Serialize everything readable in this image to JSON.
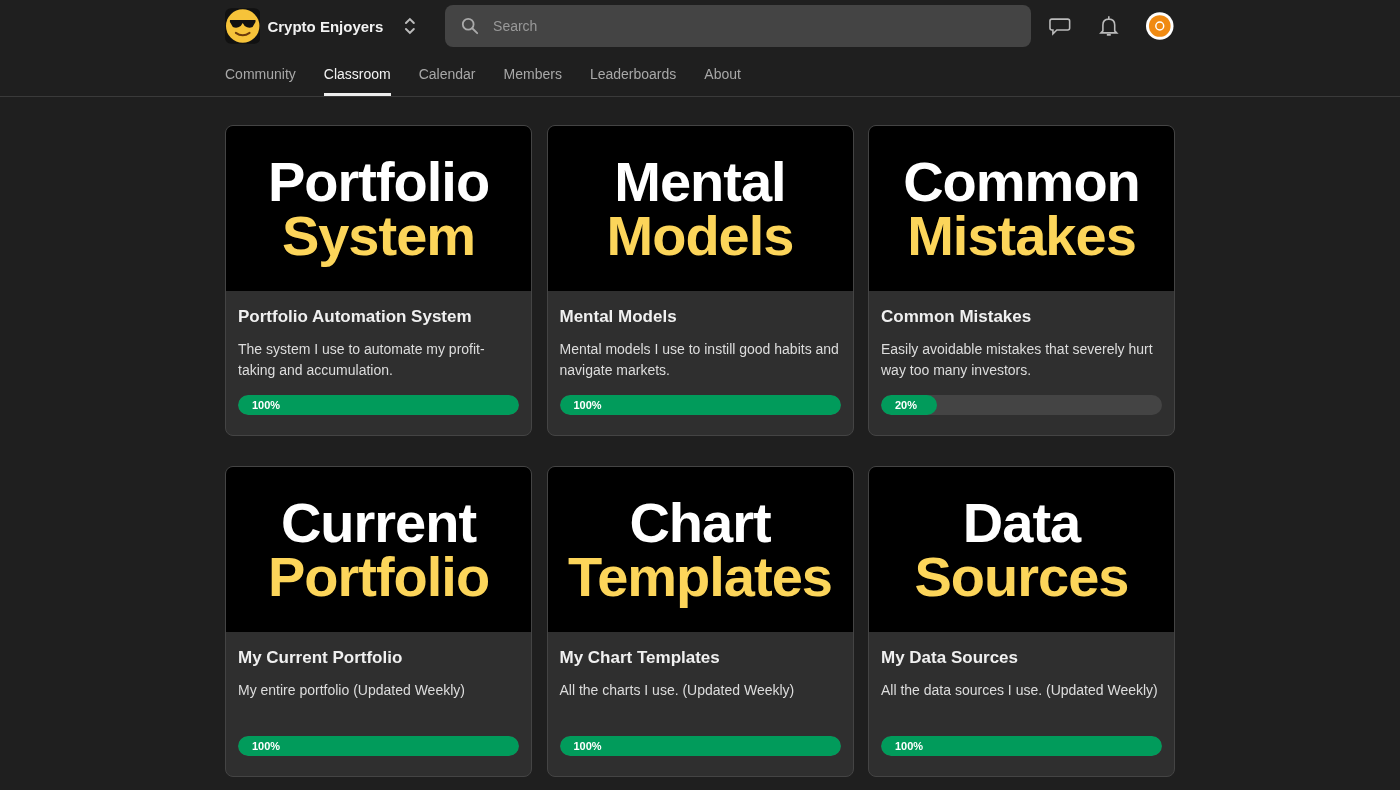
{
  "header": {
    "group_name": "Crypto Enjoyers",
    "search": {
      "placeholder": "Search"
    }
  },
  "tabs": [
    {
      "label": "Community",
      "selected": false
    },
    {
      "label": "Classroom",
      "selected": true
    },
    {
      "label": "Calendar",
      "selected": false
    },
    {
      "label": "Members",
      "selected": false
    },
    {
      "label": "Leaderboards",
      "selected": false
    },
    {
      "label": "About",
      "selected": false
    }
  ],
  "courses": [
    {
      "cover": {
        "line1": "Portfolio",
        "line2": "System"
      },
      "title": "Portfolio Automation System",
      "description": "The system I use to automate my profit-taking and accumulation.",
      "progress": "100%",
      "level": 1
    },
    {
      "cover": {
        "line1": "Mental",
        "line2": "Models"
      },
      "title": "Mental Models",
      "description": "Mental models I use to instill good habits and navigate markets.",
      "progress": "100%",
      "level": 1
    },
    {
      "cover": {
        "line1": "Common",
        "line2": "Mistakes"
      },
      "title": "Common Mistakes",
      "description": "Easily avoidable mistakes that severely hurt way too many investors.",
      "progress": "20%",
      "level": 0.2
    },
    {
      "cover": {
        "line1": "Current",
        "line2": "Portfolio"
      },
      "title": "My Current Portfolio",
      "description": "My entire portfolio (Updated Weekly)",
      "progress": "100%",
      "level": 1
    },
    {
      "cover": {
        "line1": "Chart",
        "line2": "Templates"
      },
      "title": "My Chart Templates",
      "description": "All the charts I use. (Updated Weekly)",
      "progress": "100%",
      "level": 1
    },
    {
      "cover": {
        "line1": "Data",
        "line2": "Sources"
      },
      "title": "My Data Sources",
      "description": "All the data sources I use. (Updated Weekly)",
      "progress": "100%",
      "level": 1
    }
  ]
}
